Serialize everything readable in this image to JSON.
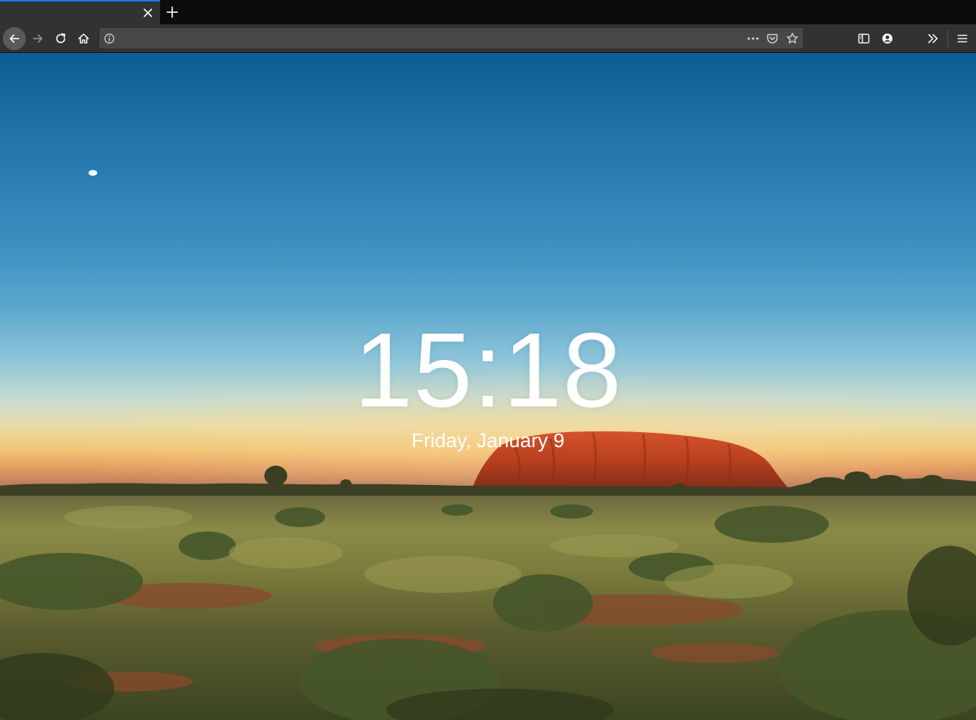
{
  "tab": {
    "title": "",
    "close_label": "Close tab"
  },
  "newtab": {
    "label": "New tab"
  },
  "navbar": {
    "url_value": "",
    "url_placeholder": ""
  },
  "icons": {
    "back": "back-arrow-icon",
    "forward": "forward-arrow-icon",
    "reload": "reload-icon",
    "home": "home-icon",
    "info": "info-icon",
    "more": "more-dots-icon",
    "pocket": "pocket-icon",
    "star": "bookmark-star-icon",
    "sidebar": "sidebar-icon",
    "account": "account-icon",
    "overflow": "overflow-chevron-icon",
    "menu": "hamburger-menu-icon"
  },
  "page": {
    "time": "15:18",
    "date": "Friday, January 9"
  },
  "colors": {
    "chrome_dark": "#0c0c0d",
    "chrome_toolbar": "#323234",
    "urlbar_bg": "#474749",
    "tab_accent": "#0a84ff",
    "clock_text": "#ffffff"
  }
}
